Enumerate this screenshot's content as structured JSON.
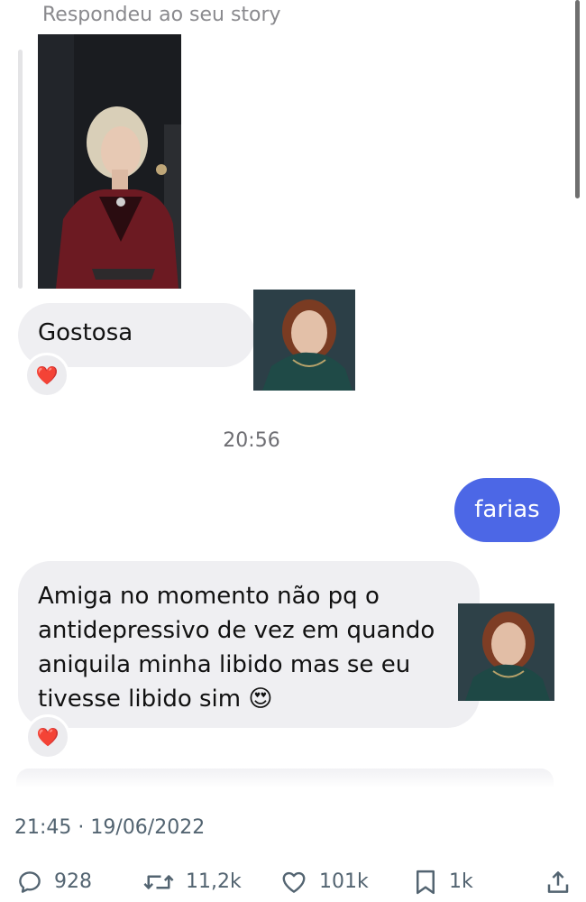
{
  "story_reply": {
    "caption": "Respondeu ao seu story"
  },
  "messages": {
    "first": {
      "text": "Gostosa",
      "reaction": "❤️"
    },
    "timestamp": "20:56",
    "outgoing": {
      "text": "farias"
    },
    "second": {
      "text": "Amiga no momento não pq o antidepressivo de vez em quando aniquila minha libido mas se eu tivesse libido sim 😍",
      "reaction": "❤️"
    }
  },
  "tweet": {
    "time": "21:45",
    "separator": "·",
    "date": "19/06/2022",
    "replies": "928",
    "retweets": "11,2k",
    "likes": "101k",
    "bookmarks": "1k"
  },
  "icons": {
    "reply": "reply-icon",
    "retweet": "retweet-icon",
    "like": "heart-icon",
    "bookmark": "bookmark-icon",
    "share": "share-icon"
  },
  "colors": {
    "outgoing_bubble": "#4c67e6",
    "incoming_bubble": "#efeff2",
    "meta_text": "#536471"
  }
}
